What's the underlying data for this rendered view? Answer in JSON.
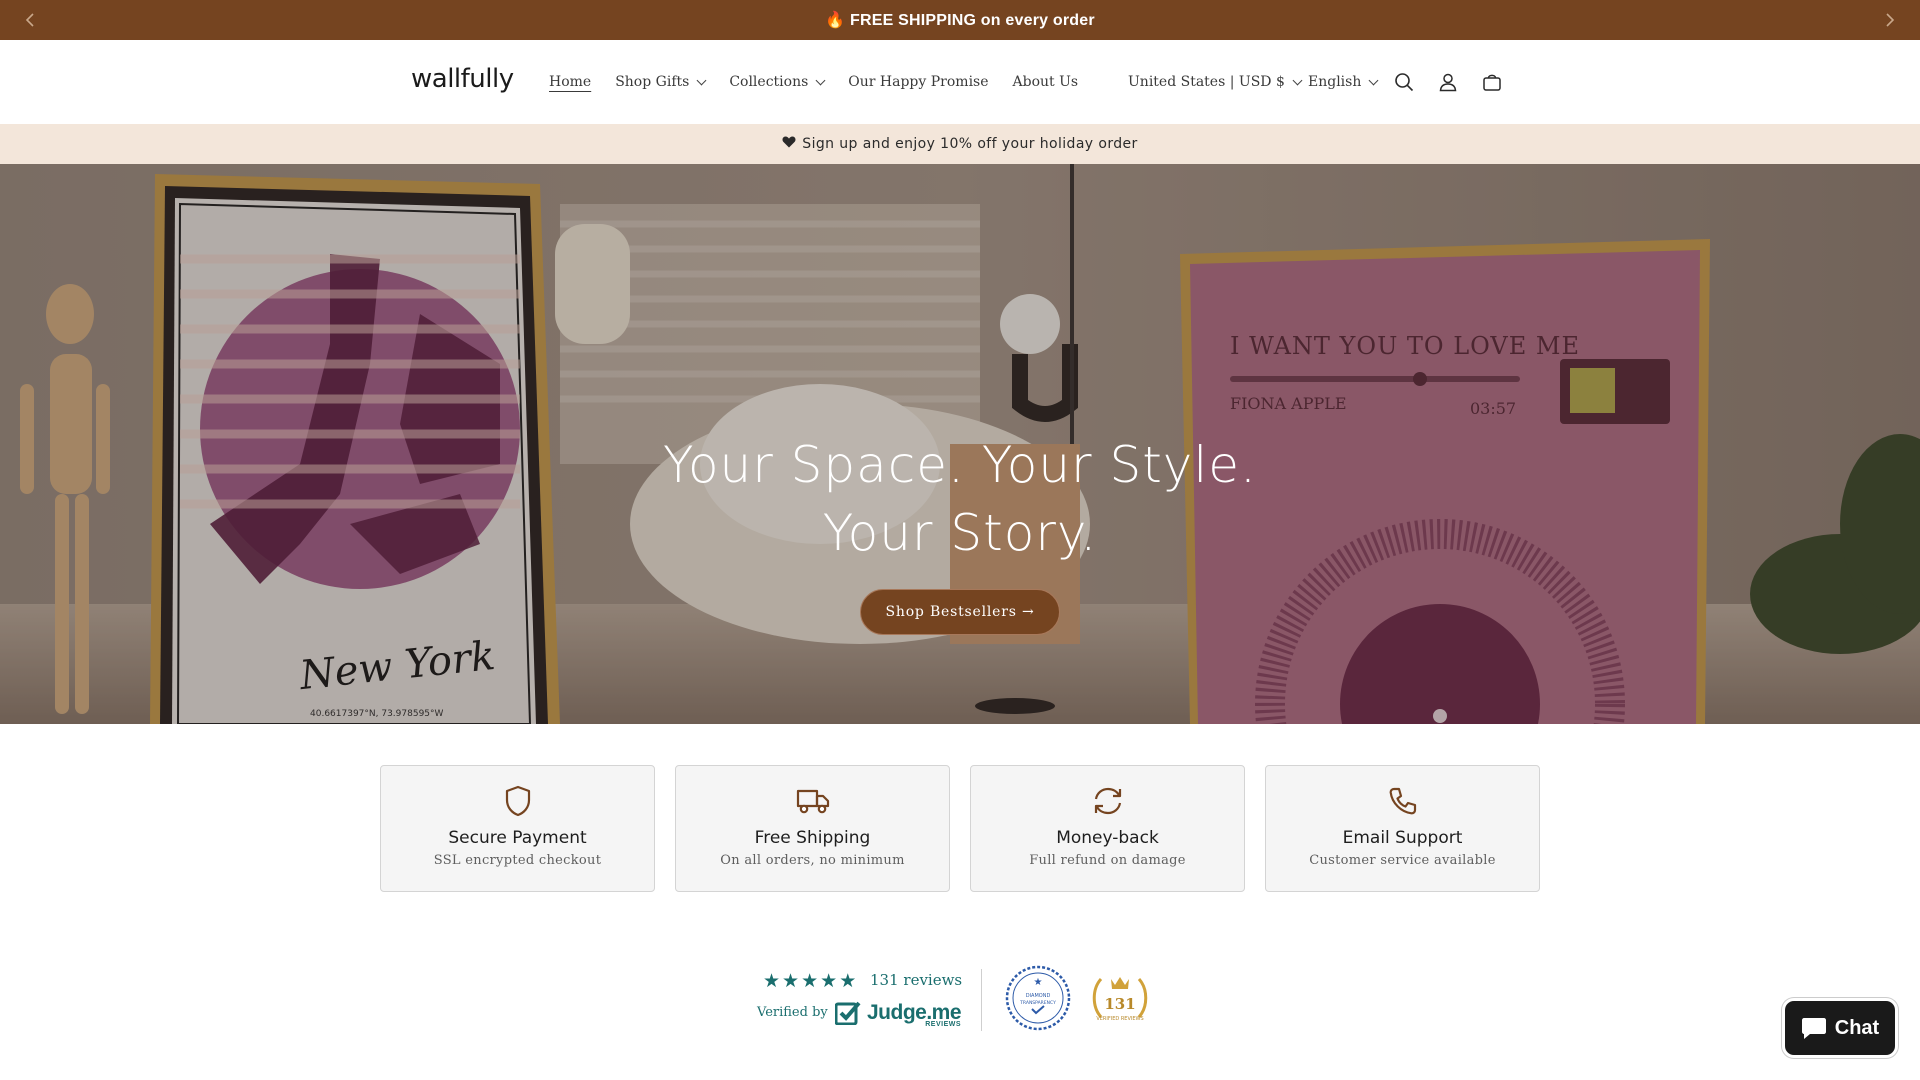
{
  "announcement": {
    "text": "🔥 FREE SHIPPING on every order",
    "prev_icon": "chevron-left-icon",
    "next_icon": "chevron-right-icon"
  },
  "header": {
    "logo": "wallfully",
    "nav": [
      {
        "label": "Home",
        "active": true,
        "dropdown": false
      },
      {
        "label": "Shop Gifts",
        "active": false,
        "dropdown": true
      },
      {
        "label": "Collections",
        "active": false,
        "dropdown": true
      },
      {
        "label": "Our Happy Promise",
        "active": false,
        "dropdown": false
      },
      {
        "label": "About Us",
        "active": false,
        "dropdown": false
      }
    ],
    "country_selector": "United States | USD $",
    "language_selector": "English",
    "icons": [
      "search-icon",
      "account-icon",
      "cart-icon"
    ]
  },
  "promo": {
    "icon": "heart-icon",
    "text": "Sign up and enjoy 10% off your holiday order"
  },
  "hero": {
    "title_line1": "Your Space. Your Style.",
    "title_line2": "Your Story.",
    "button": "Shop Bestsellers →",
    "poster_left_text": "New York",
    "poster_left_coords": "40.6617397°N, 73.978595°W",
    "poster_right_title": "I WANT YOU TO LOVE ME",
    "poster_right_artist": "FIONA APPLE",
    "poster_right_time": "03:57"
  },
  "features": [
    {
      "icon": "shield-icon",
      "title": "Secure Payment",
      "subtitle": "SSL encrypted checkout"
    },
    {
      "icon": "truck-icon",
      "title": "Free Shipping",
      "subtitle": "On all orders, no minimum"
    },
    {
      "icon": "refresh-icon",
      "title": "Money-back",
      "subtitle": "Full refund on damage"
    },
    {
      "icon": "phone-icon",
      "title": "Email Support",
      "subtitle": "Customer service available"
    }
  ],
  "reviews": {
    "stars": 5,
    "count_label": "131 reviews",
    "verified_by": "Verified by",
    "provider": "Judge.me",
    "provider_sub": "REVIEWS",
    "badge_transparency": "DIAMOND TRANSPARENCY",
    "badge_verified_count": "131",
    "badge_verified_label": "VERIFIED REVIEWS"
  },
  "chat": {
    "label": "Chat",
    "icon": "chat-bubble-icon"
  },
  "colors": {
    "brand_brown": "#754420",
    "promo_bg": "#f3e6da",
    "review_teal": "#1a6e6e",
    "badge_gold": "#d1a23a",
    "badge_blue": "#2c5aa8"
  }
}
